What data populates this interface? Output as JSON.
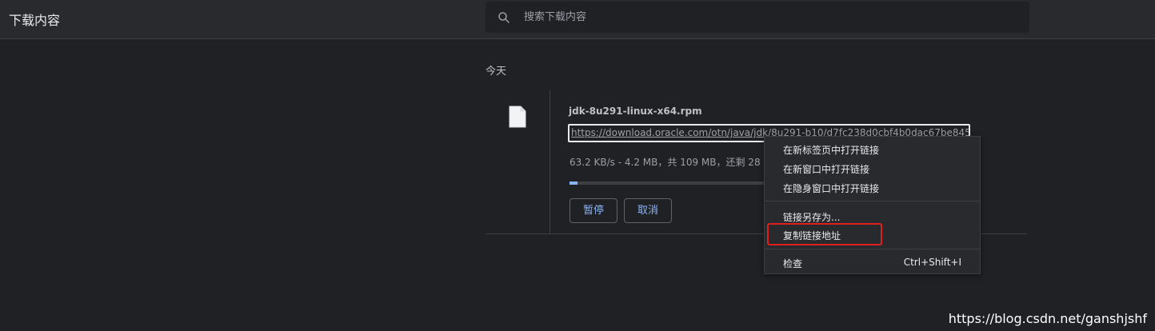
{
  "header": {
    "title": "下载内容",
    "search_placeholder": "搜索下载内容"
  },
  "section": {
    "date_label": "今天"
  },
  "download": {
    "file_name": "jdk-8u291-linux-x64.rpm",
    "url": "https://download.oracle.com/otn/java/jdk/8u291-b10/d7fc238d0cbf4b0dac67be845...",
    "status": "63.2 KB/s - 4.2 MB，共 109 MB，还剩 28",
    "progress_percent": 4,
    "pause_label": "暂停",
    "cancel_label": "取消"
  },
  "context_menu": {
    "items": [
      {
        "label": "在新标签页中打开链接"
      },
      {
        "label": "在新窗口中打开链接"
      },
      {
        "label": "在隐身窗口中打开链接"
      },
      {
        "label": "链接另存为..."
      },
      {
        "label": "复制链接地址",
        "highlighted": true
      },
      {
        "label": "检查",
        "shortcut": "Ctrl+Shift+I"
      }
    ]
  },
  "watermark": "https://blog.csdn.net/ganshjshf",
  "colors": {
    "background": "#202124",
    "header": "#292a2d",
    "accent": "#8ab4f8",
    "highlight": "#e02020"
  }
}
